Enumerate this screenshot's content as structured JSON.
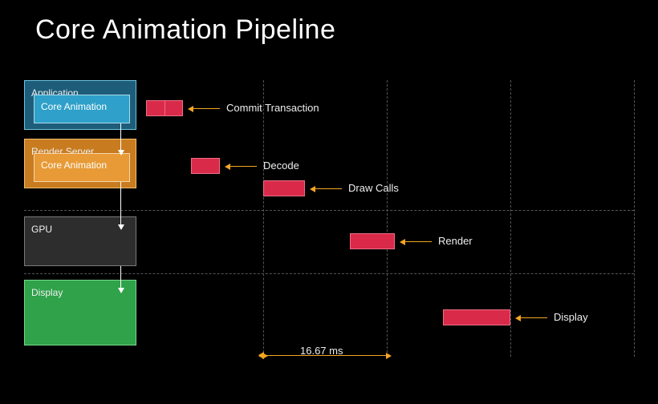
{
  "title": "Core Animation Pipeline",
  "panels": {
    "application": {
      "label": "Application",
      "inner": "Core Animation"
    },
    "render_server": {
      "label": "Render Server",
      "inner": "Core Animation"
    },
    "gpu": {
      "label": "GPU"
    },
    "display": {
      "label": "Display"
    }
  },
  "stages": {
    "commit": "Commit Transaction",
    "decode": "Decode",
    "draw_calls": "Draw Calls",
    "render": "Render",
    "display": "Display"
  },
  "timing": {
    "frame_ms": "16.67 ms"
  }
}
